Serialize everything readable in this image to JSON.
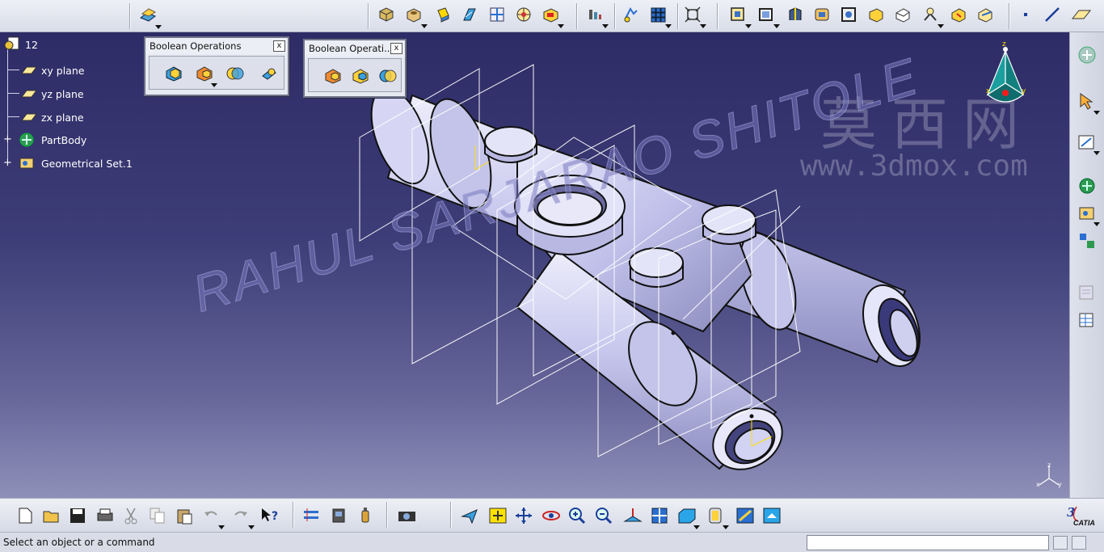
{
  "app": {
    "name": "CATIA",
    "logo_text": "CATIA"
  },
  "spec_tree": {
    "root_label": "12",
    "items": [
      {
        "label": "xy plane",
        "icon": "plane-icon"
      },
      {
        "label": "yz plane",
        "icon": "plane-icon"
      },
      {
        "label": "zx plane",
        "icon": "plane-icon"
      },
      {
        "label": "PartBody",
        "icon": "partbody-icon"
      },
      {
        "label": "Geometrical Set.1",
        "icon": "geometrical-set-icon"
      }
    ]
  },
  "floating_toolbars": [
    {
      "title": "Boolean Operations",
      "close": "x"
    },
    {
      "title": "Boolean Operati...",
      "close": "x"
    }
  ],
  "watermarks": {
    "chinese": "莫西网",
    "url": "www.3dmox.com",
    "author": "RAHUL SARJARAO SHITOLE"
  },
  "compass_axes": {
    "x": "x",
    "y": "y",
    "z": "z"
  },
  "status": {
    "message": "Select an object or a command",
    "command_value": ""
  },
  "colors": {
    "viewport_top": "#2e2c66",
    "viewport_bottom": "#8e90b8",
    "part_fill": "#c8c8ee",
    "wireframe": "#ffffff",
    "axis_yellow": "#ffe100"
  }
}
